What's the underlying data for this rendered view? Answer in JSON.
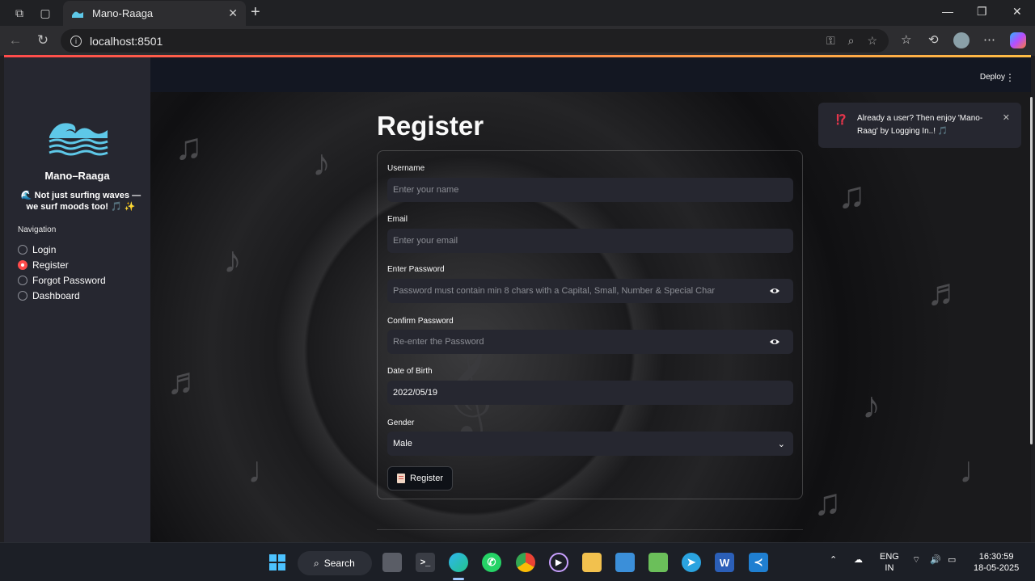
{
  "browser": {
    "tab_title": "Mano-Raaga",
    "url": "localhost:8501"
  },
  "sidebar": {
    "app_name": "Mano–Raaga",
    "tagline": "🌊 Not just surfing waves — we surf moods too! 🎵 ✨",
    "nav_title": "Navigation",
    "nav_items": [
      "Login",
      "Register",
      "Forgot Password",
      "Dashboard"
    ],
    "selected": "Register"
  },
  "topbar": {
    "deploy_label": "Deploy"
  },
  "main": {
    "title": "Register",
    "fields": {
      "username_label": "Username",
      "username_placeholder": "Enter your name",
      "email_label": "Email",
      "email_placeholder": "Enter your email",
      "password_label": "Enter Password",
      "password_placeholder": "Password must contain min 8 chars with a Capital, Small, Number & Special Char",
      "confirm_label": "Confirm Password",
      "confirm_placeholder": "Re-enter the Password",
      "dob_label": "Date of Birth",
      "dob_value": "2022/05/19",
      "gender_label": "Gender",
      "gender_value": "Male"
    },
    "register_button": "Register"
  },
  "toast": {
    "icon": "⁉️",
    "message": "Already a user? Then enjoy 'Mano-Raag' by Logging In..! 🎵"
  },
  "taskbar": {
    "search_label": "Search",
    "lang_line1": "ENG",
    "lang_line2": "IN",
    "time": "16:30:59",
    "date": "18-05-2025"
  },
  "colors": {
    "accent": "#ff4b4b",
    "sidebar_bg": "#262730",
    "app_bg": "#0e1117",
    "wave": "#5ec8e8"
  }
}
